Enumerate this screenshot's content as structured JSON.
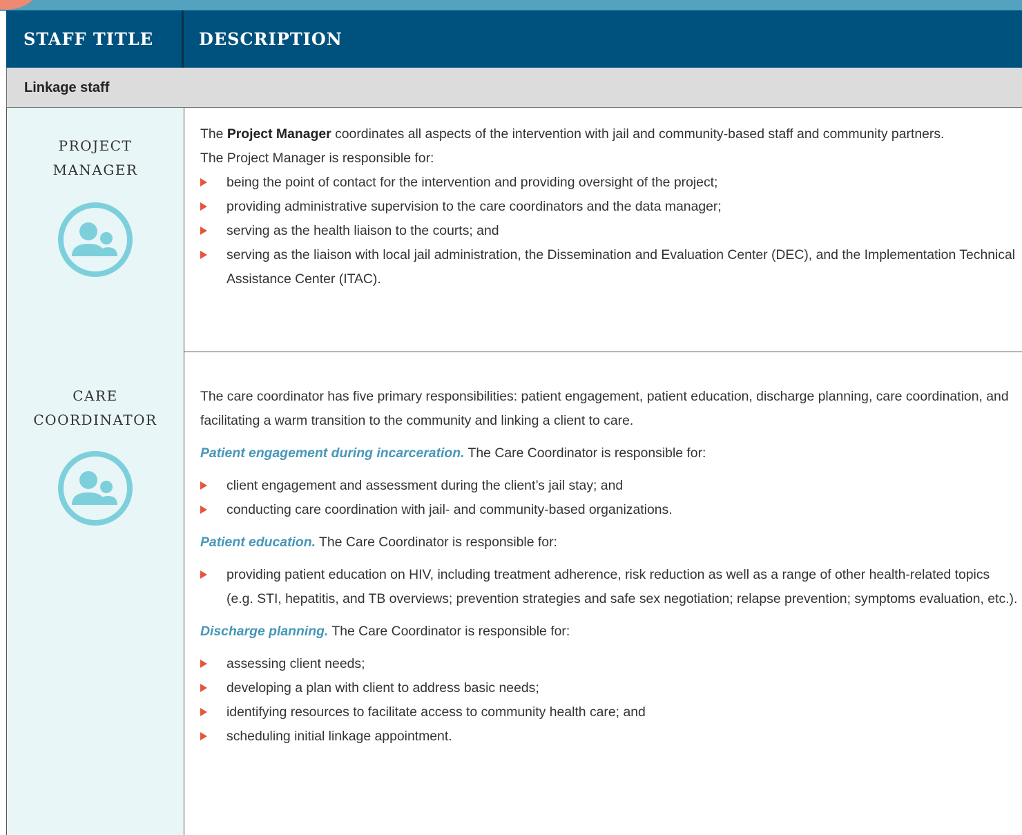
{
  "header": {
    "col1": "STAFF TITLE",
    "col2": "DESCRIPTION"
  },
  "section": {
    "label": "Linkage staff"
  },
  "project_manager": {
    "title_lines": [
      "PROJECT",
      "MANAGER"
    ],
    "icon": "people-icon",
    "intro_pre": "The ",
    "intro_bold": "Project Manager",
    "intro_post": " coordinates all aspects of the intervention with jail and community-based staff and community partners.",
    "resp_intro": "The Project Manager is responsible for:",
    "bullets": [
      "being the point of contact for the intervention and providing oversight of the project;",
      "providing administrative supervision to the care coordinators and the data manager;",
      "serving as the health liaison to the courts; and",
      "serving as the liaison with local jail administration, the Dissemination and Evaluation Center (DEC), and the Implementation Technical Assistance Center (ITAC)."
    ]
  },
  "care_coordinator": {
    "title_lines": [
      "CARE",
      "COORDINATOR"
    ],
    "icon": "people-icon",
    "intro": "The care coordinator has five primary responsibilities: patient engagement, patient education, discharge planning, care coordination, and facilitating a warm transition to the community and linking a client to care.",
    "sub1": {
      "head": "Patient engagement during incarceration.",
      "rest": " The Care Coordinator is responsible for:"
    },
    "bullets1": [
      "client engagement and assessment during the client’s jail stay; and",
      "conducting care coordination with jail- and community-based organizations."
    ],
    "sub2": {
      "head": "Patient education.",
      "rest": " The Care Coordinator is responsible for:"
    },
    "bullets2": [
      "providing patient education on HIV, including treatment adherence, risk reduction as well as a range of other health-related topics (e.g. STI, hepatitis, and TB overviews; prevention strategies and safe sex negotiation; relapse prevention; symptoms evaluation, etc.)."
    ],
    "sub3": {
      "head": "Discharge planning.",
      "rest": " The Care Coordinator is responsible for:"
    },
    "bullets3": [
      "assessing client needs;",
      "developing a plan with client to address basic needs;",
      "identifying resources to facilitate access to community health care; and",
      "scheduling initial linkage appointment."
    ]
  },
  "colors": {
    "header_bg": "#00527e",
    "top_band": "#52a2c0",
    "accent_blob": "#ee8a72",
    "section_bg": "#dcdcdd",
    "left_col_bg": "#e9f6f8",
    "icon_teal": "#7dd0db",
    "subhead_blue": "#4797b8",
    "bullet_arrow": "#e5553a"
  }
}
